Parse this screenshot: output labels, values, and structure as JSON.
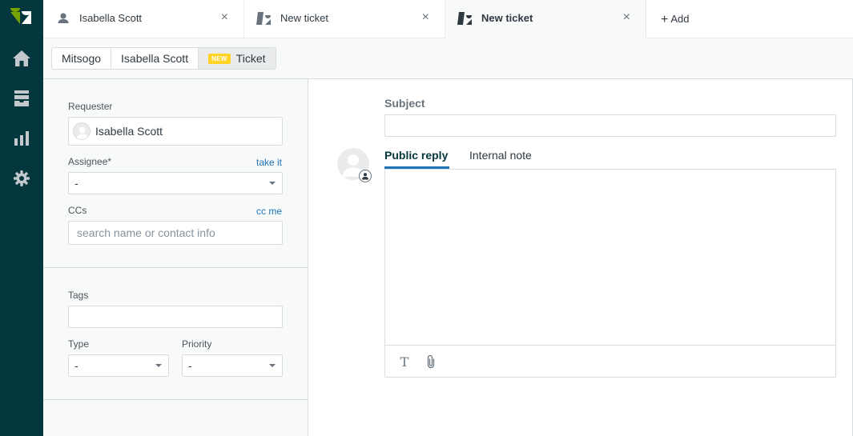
{
  "nav": {
    "items": [
      {
        "name": "home-icon"
      },
      {
        "name": "views-icon"
      },
      {
        "name": "reporting-icon"
      },
      {
        "name": "admin-gear-icon"
      }
    ],
    "colors": {
      "background": "#03363d",
      "logo_green": "#78a300",
      "logo_white": "#ffffff"
    }
  },
  "tabs": [
    {
      "label": "Isabella Scott",
      "icon": "user-icon",
      "close": "×",
      "active": false
    },
    {
      "label": "New ticket",
      "icon": "ticket-icon",
      "close": "×",
      "active": false
    },
    {
      "label": "New ticket",
      "icon": "ticket-icon",
      "close": "×",
      "active": true
    }
  ],
  "add_tab": {
    "icon": "+",
    "label": "Add"
  },
  "breadcrumb": {
    "items": [
      "Mitsogo",
      "Isabella Scott"
    ],
    "current_badge": "NEW",
    "current_label": "Ticket"
  },
  "form": {
    "requester": {
      "label": "Requester",
      "value": "Isabella Scott"
    },
    "assignee": {
      "label": "Assignee*",
      "action": "take it",
      "value": "-"
    },
    "ccs": {
      "label": "CCs",
      "action": "cc me",
      "placeholder": "search name or contact info"
    },
    "tags": {
      "label": "Tags",
      "value": ""
    },
    "type": {
      "label": "Type",
      "value": "-"
    },
    "priority": {
      "label": "Priority",
      "value": "-"
    }
  },
  "editor": {
    "subject_label": "Subject",
    "subject_value": "",
    "tabs": [
      "Public reply",
      "Internal note"
    ],
    "active_tab": "Public reply",
    "toolbar": [
      {
        "name": "text-format-icon",
        "glyph": "T"
      },
      {
        "name": "attachment-icon"
      }
    ]
  },
  "colors": {
    "accent": "#1f73b7",
    "badge_new": "#ffd424",
    "text": "#2f3941"
  }
}
